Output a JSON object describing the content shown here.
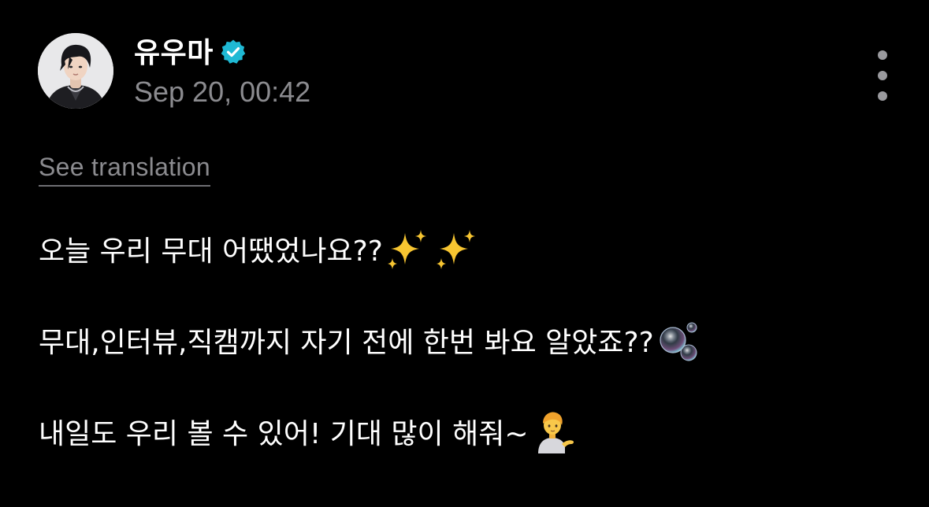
{
  "author": {
    "name": "유우마",
    "verified": true,
    "verified_color": "#1fb9d4",
    "avatar_icon": "profile-photo"
  },
  "post": {
    "timestamp": "Sep 20, 00:42",
    "see_translation_label": "See translation",
    "lines": [
      {
        "text": "오늘 우리 무대 어땠었나요??",
        "emoji": "sparkles-icon ×2"
      },
      {
        "text": "무대,인터뷰,직캠까지 자기 전에 한번 봐요 알았죠??",
        "emoji": "bubbles-icon"
      },
      {
        "text": "내일도 우리 볼 수 있어! 기대 많이 해줘~",
        "emoji": "information-desk-person-icon"
      }
    ]
  },
  "colors": {
    "background": "#000000",
    "text": "#ffffff",
    "muted": "#8b8b8f"
  }
}
